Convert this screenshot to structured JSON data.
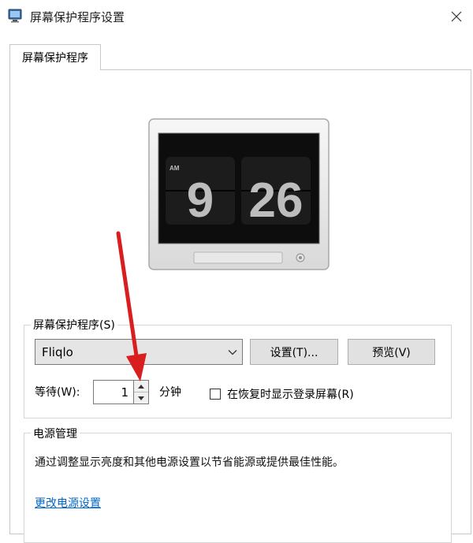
{
  "window": {
    "title": "屏幕保护程序设置",
    "close_glyph": "✕"
  },
  "tabs": [
    {
      "label": "屏幕保护程序",
      "selected": true
    }
  ],
  "preview": {
    "clock": {
      "ampm": "AM",
      "hour": "9",
      "minute": "26"
    }
  },
  "screensaver_group": {
    "legend": "屏幕保护程序(S)",
    "selected_saver": "Fliqlo",
    "settings_button": "设置(T)...",
    "preview_button": "预览(V)",
    "wait_label": "等待(W):",
    "wait_value": "1",
    "wait_unit": "分钟",
    "resume_checkbox_label": "在恢复时显示登录屏幕(R)",
    "resume_checked": false
  },
  "power_group": {
    "legend": "电源管理",
    "description": "通过调整显示亮度和其他电源设置以节省能源或提供最佳性能。",
    "link": "更改电源设置"
  },
  "colors": {
    "arrow": "#d81e1e",
    "link": "#0066cc",
    "monitor_bezel": "#ececec",
    "screen": "#111111"
  }
}
